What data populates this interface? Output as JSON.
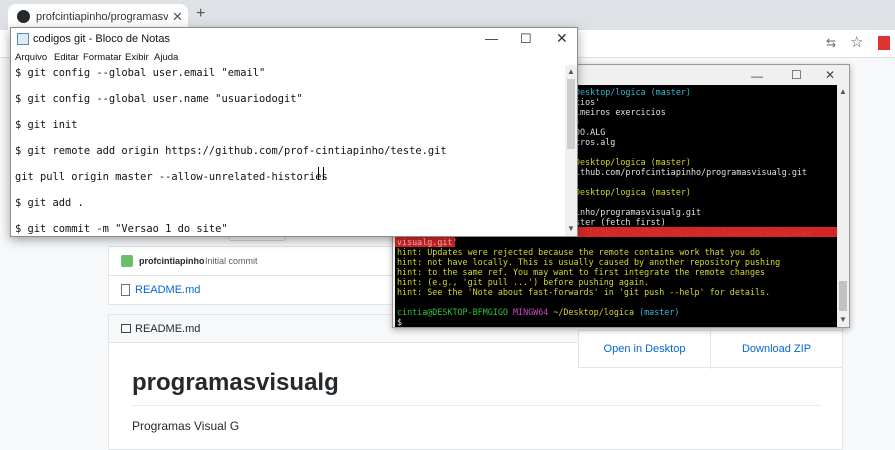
{
  "browser": {
    "tab_title": "profcintiapinho/programasvisualg",
    "tab_close": "✕",
    "new_tab": "+",
    "translate_icon": "translate-icon",
    "star_icon": "star-icon",
    "star": "☆"
  },
  "github": {
    "commit_user": "profcintiapinho",
    "commit_message": "Initial commit",
    "readme_file": "README.md",
    "readme_header": "README.md",
    "repo_title": "programasvisualg",
    "repo_description": "Programas Visual G",
    "clone_open_desktop": "Open in Desktop",
    "clone_download_zip": "Download ZIP"
  },
  "terminal": {
    "min": "—",
    "max": "☐",
    "close": "✕",
    "lines": [
      {
        "text": "cintia@DESKTOP-BFMGIGO MINGW64 ~/Desktop/logica (master)",
        "partial": "Desktop/logica (master)"
      },
      {
        "text": "cios'"
      },
      {
        "text": "imeiros exercicios"
      },
      {
        "text": ")"
      },
      {
        "text": "DO.ALG"
      },
      {
        "text": "tros.alg"
      },
      {
        "text": ""
      },
      {
        "text": "Desktop/logica (master)"
      },
      {
        "text": "ithub.com/profcintiapinho/programasvisualg.git"
      },
      {
        "text": ""
      },
      {
        "text": "Desktop/logica (master)"
      },
      {
        "text": ""
      },
      {
        "text": "inho/programasvisualg.git"
      },
      {
        "text": "ster (fetch first)"
      },
      {
        "text": "o 'https://github.com/profcintiapinho/programas"
      },
      {
        "text": "visualg.git'"
      },
      {
        "text": "hint: Updates were rejected because the remote contains work that you do"
      },
      {
        "text": "hint: not have locally. This is usually caused by another repository pushing"
      },
      {
        "text": "hint: to the same ref. You may want to first integrate the remote changes"
      },
      {
        "text": "hint: (e.g., 'git pull ...') before pushing again."
      },
      {
        "text": "hint: See the 'Note about fast-forwards' in 'git push --help' for details."
      },
      {
        "text": ""
      },
      {
        "text": "cintia@DESKTOP-BFMGIGO MINGW64 ~/Desktop/logica (master)"
      },
      {
        "text": "$"
      }
    ],
    "prompt_user": "cintia@DESKTOP-BFMGIGO",
    "prompt_mingw": "MINGW64",
    "prompt_path": "~/Desktop/logica",
    "prompt_branch": "(master)"
  },
  "notepad": {
    "title": "codigos git - Bloco de Notas",
    "min": "—",
    "max": "☐",
    "close": "✕",
    "menu": [
      "Arquivo",
      "Editar",
      "Formatar",
      "Exibir",
      "Ajuda"
    ],
    "lines": [
      "$ git config --global user.email \"email\"",
      "$ git config --global user.name \"usuariodogit\"",
      "$ git init",
      "$ git remote add origin https://github.com/prof-cintiapinho/teste.git",
      "git pull origin master --allow-unrelated-histories",
      "$ git add .",
      "$ git commit -m \"Versao 1 do site\""
    ]
  }
}
